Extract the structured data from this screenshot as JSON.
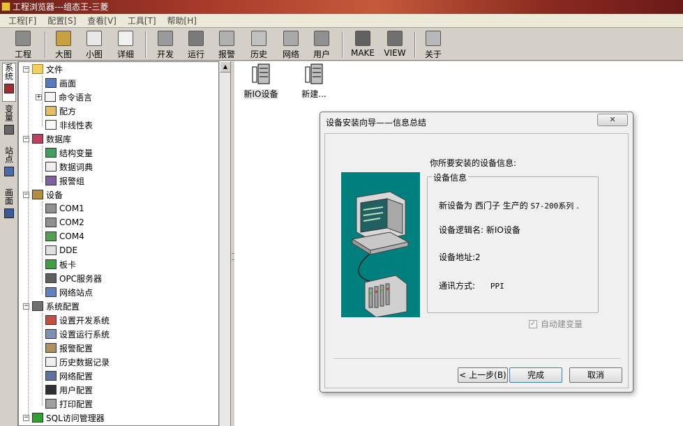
{
  "window": {
    "title": "工程浏览器---组态王-三菱"
  },
  "menu": [
    "工程[F]",
    "配置[S]",
    "查看[V]",
    "工具[T]",
    "帮助[H]"
  ],
  "toolbar": {
    "project": "工程",
    "large_icon": "大图",
    "small_icon": "小图",
    "detail": "详细",
    "develop": "开发",
    "run": "运行",
    "alarm": "报警",
    "history": "历史",
    "network": "网络",
    "user": "用户",
    "make": "MAKE",
    "view": "VIEW",
    "about": "关于"
  },
  "side_tabs": [
    "系统",
    "变量",
    "站点",
    "画面"
  ],
  "tree": {
    "file": "文件",
    "screen": "画面",
    "command_lang": "命令语言",
    "recipe": "配方",
    "nonlinear": "非线性表",
    "database": "数据库",
    "struct_var": "结构变量",
    "data_dict": "数据词典",
    "alarm_group": "报警组",
    "device": "设备",
    "com1": "COM1",
    "com2": "COM2",
    "com4": "COM4",
    "dde": "DDE",
    "board": "板卡",
    "opc": "OPC服务器",
    "net_station": "网络站点",
    "sys_config": "系统配置",
    "dev_sys": "设置开发系统",
    "run_sys": "设置运行系统",
    "alarm_cfg": "报警配置",
    "history_rec": "历史数据记录",
    "net_cfg": "网络配置",
    "user_cfg": "用户配置",
    "print_cfg": "打印配置",
    "sql": "SQL访问管理器"
  },
  "devices": [
    "新IO设备",
    "新建..."
  ],
  "dialog": {
    "title": "设备安装向导——信息总结",
    "close": "✕",
    "heading": "你所要安装的设备信息:",
    "group_title": "设备信息",
    "line1_prefix": "新设备为",
    "line1_vendor": "西门子",
    "line1_mid": "生产的",
    "line1_model": "S7-200系列",
    "line1_suffix": ".",
    "logical_name_label": "设备逻辑名:",
    "logical_name_value": "新IO设备",
    "address_label": "设备地址:",
    "address_value": "2",
    "comm_label": "通讯方式:",
    "comm_value": "PPI",
    "auto_var_label": "自动建变量",
    "auto_var_checked": "✓",
    "prev_button": "< 上一步(B)",
    "finish_button": "完成",
    "cancel_button": "取消"
  }
}
